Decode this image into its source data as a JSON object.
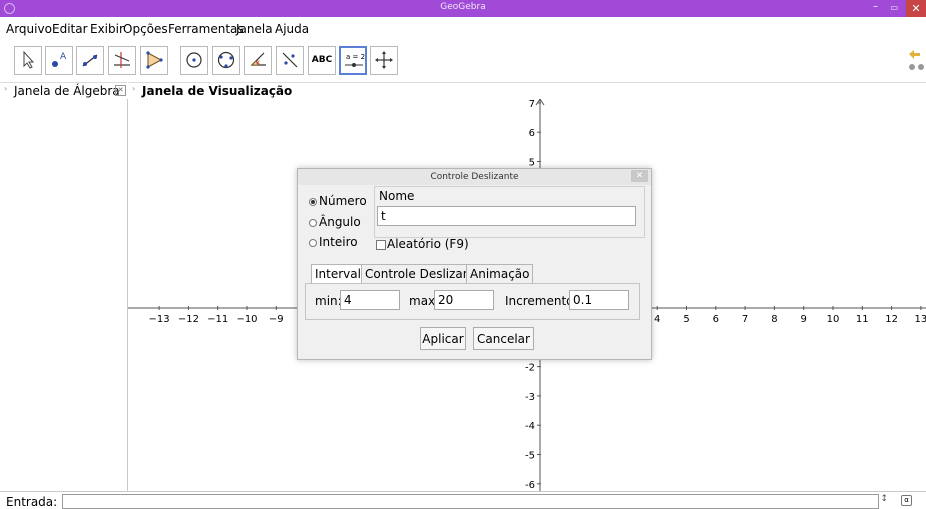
{
  "window": {
    "title": "GeoGebra",
    "controls": {
      "minimize": "–",
      "restore": "🗗",
      "close": "✕"
    }
  },
  "menu": [
    "Arquivo",
    "Editar",
    "Exibir",
    "Opções",
    "Ferramentas",
    "Janela",
    "Ajuda"
  ],
  "toolbar": {
    "tools": [
      {
        "name": "move-tool",
        "icon": "arrow-icon"
      },
      {
        "name": "point-tool",
        "icon": "point-icon",
        "label": "A"
      },
      {
        "name": "line-tool",
        "icon": "line-icon"
      },
      {
        "name": "perpendicular-tool",
        "icon": "perpendicular-icon"
      },
      {
        "name": "polygon-tool",
        "icon": "polygon-icon"
      },
      {
        "name": "circle-tool",
        "icon": "circle-icon"
      },
      {
        "name": "ellipse-tool",
        "icon": "ellipse-icon"
      },
      {
        "name": "angle-tool",
        "icon": "angle-icon"
      },
      {
        "name": "reflect-tool",
        "icon": "reflect-icon"
      },
      {
        "name": "text-tool",
        "icon": "text-icon",
        "label": "ABC"
      },
      {
        "name": "slider-tool",
        "icon": "slider-icon",
        "label": "a = 2"
      },
      {
        "name": "move-view-tool",
        "icon": "move-view-icon"
      }
    ],
    "selected": "slider-tool"
  },
  "algebra_view": {
    "title": "Janela de Álgebra"
  },
  "graphics_view": {
    "title": "Janela de Visualização",
    "x_ticks_left": [
      "−13",
      "−12",
      "−11",
      "−10",
      "−9"
    ],
    "x_ticks_right": [
      "4",
      "5",
      "6",
      "7",
      "8",
      "9",
      "10",
      "11",
      "12",
      "13"
    ],
    "y_ticks_top": [
      "7",
      "6",
      "5"
    ],
    "y_ticks_bottom": [
      "-2",
      "-3",
      "-4",
      "-5",
      "-6"
    ]
  },
  "input_bar": {
    "label": "Entrada:"
  },
  "dialog": {
    "title": "Controle Deslizante",
    "types": [
      {
        "label": "Número",
        "selected": true
      },
      {
        "label": "Ângulo",
        "selected": false
      },
      {
        "label": "Inteiro",
        "selected": false
      }
    ],
    "name_label": "Nome",
    "name_value": "t",
    "random_label": "Aleatório (F9)",
    "tabs": [
      "Intervalo",
      "Controle Deslizante",
      "Animação"
    ],
    "active_tab": "Intervalo",
    "min_label": "min:",
    "min_value": "4",
    "max_label": "max:",
    "max_value": "20",
    "increment_label": "Incremento:",
    "increment_value": "0.1",
    "apply_label": "Aplicar",
    "cancel_label": "Cancelar"
  }
}
